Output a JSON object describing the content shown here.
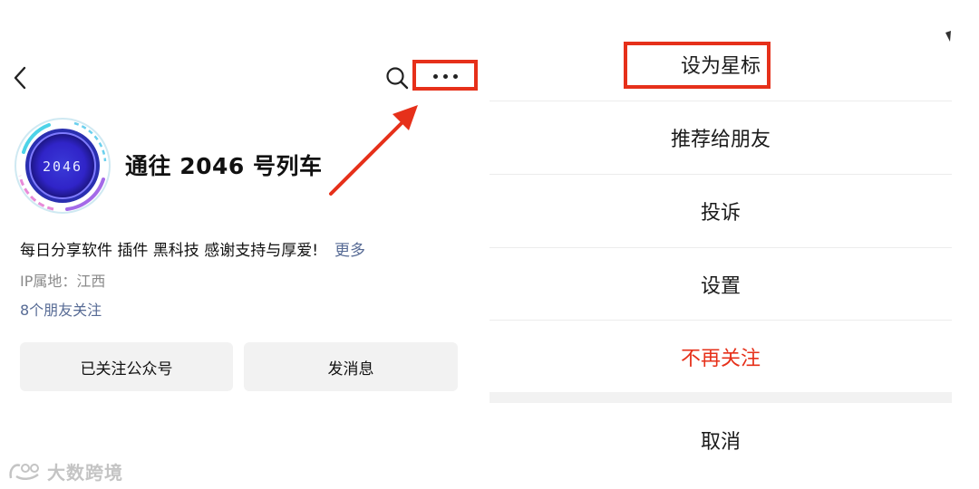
{
  "profile": {
    "avatar_text": "2046",
    "name": "通往 2046 号列车",
    "description": "每日分享软件 插件 黑科技 感谢支持与厚爱!",
    "more_link": "更多",
    "ip_location": "IP属地：江西",
    "friends_following": "8个朋友关注"
  },
  "actions": {
    "followed_label": "已关注公众号",
    "message_label": "发消息"
  },
  "menu": {
    "items": [
      {
        "label": "设为星标"
      },
      {
        "label": "推荐给朋友"
      },
      {
        "label": "投诉"
      },
      {
        "label": "设置"
      },
      {
        "label": "不再关注"
      }
    ],
    "cancel": "取消"
  },
  "watermark": "大数跨境",
  "colors": {
    "highlight": "#e6301a",
    "link": "#576b95",
    "danger": "#e6301a",
    "button_bg": "#f2f2f2",
    "avatar_core": "#3b2bd0"
  },
  "icons": [
    "back-chevron-icon",
    "search-icon",
    "more-dots-icon",
    "arrow-annotation",
    "watermark-logo-icon"
  ]
}
